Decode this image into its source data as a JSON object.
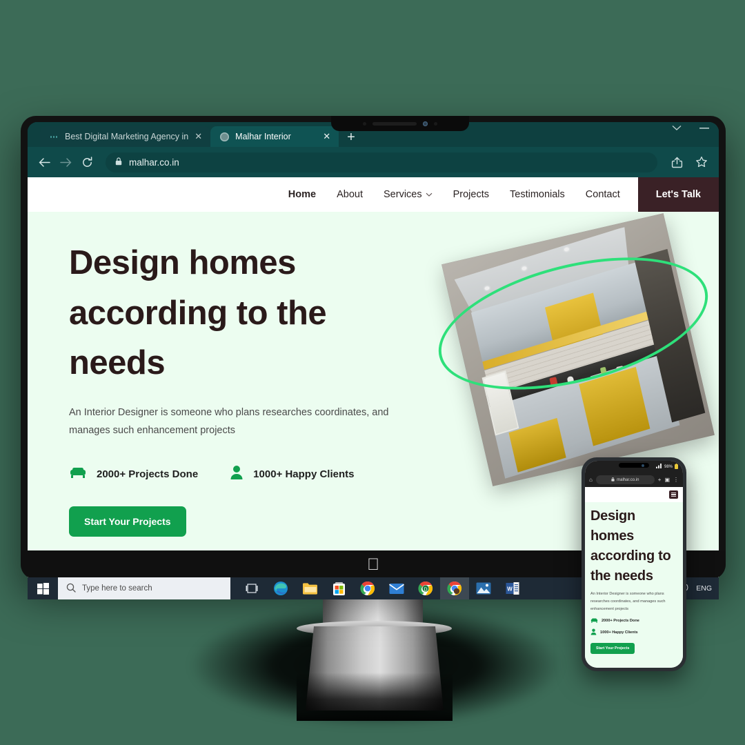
{
  "background_color": "#3c6b57",
  "browser": {
    "tabs": [
      {
        "title": "Best Digital Marketing Agency in",
        "favicon": "dots-icon",
        "close": "✕",
        "active": false
      },
      {
        "title": "Malhar Interior",
        "favicon": "globe-icon",
        "close": "✕",
        "active": true
      }
    ],
    "new_tab_label": "+",
    "window_controls": [
      "chevron-down-icon",
      "minimize-icon"
    ],
    "toolbar": {
      "back": "←",
      "forward": "→",
      "reload": "⟳",
      "lock": "🔒",
      "url": "malhar.co.in",
      "share": "share-icon",
      "bookmark": "star-icon"
    },
    "chrome_color": "#0f4a4a"
  },
  "site": {
    "nav": {
      "items": [
        {
          "label": "Home",
          "active": true
        },
        {
          "label": "About",
          "active": false
        },
        {
          "label": "Services",
          "active": false,
          "caret": "⌄"
        },
        {
          "label": "Projects",
          "active": false
        },
        {
          "label": "Testimonials",
          "active": false
        },
        {
          "label": "Contact",
          "active": false
        }
      ],
      "cta_label": "Let's Talk"
    },
    "hero": {
      "heading": "Design homes according to the needs",
      "paragraph": "An Interior Designer is someone who plans researches coordinates, and manages such enhancement projects",
      "stats": [
        {
          "icon": "sofa-icon",
          "label": "2000+ Projects Done"
        },
        {
          "icon": "person-icon",
          "label": "1000+ Happy Clients"
        }
      ],
      "button_label": "Start Your Projects",
      "bg_color": "#ecfdf0",
      "accent_green": "#11a04e",
      "ring_color": "#2ee07a",
      "heading_color": "#2a1a1a",
      "image_alt": "modular-kitchen-photo"
    }
  },
  "phone": {
    "status": {
      "signal": "signal-icon",
      "battery_text": "98%",
      "battery": "battery-icon"
    },
    "browser": {
      "home": "⌂",
      "lock": "🔒",
      "url": "malhar.co.in",
      "new_tab": "+",
      "tabs": "▣",
      "menu": "⋮"
    },
    "menu_icon": "hamburger-icon",
    "heading": "Design homes according to the needs",
    "paragraph": "An Interior Designer is someone who plans researches coordinates, and manages such enhancement projects",
    "stats": [
      "2000+ Projects Done",
      "1000+ Happy Clients"
    ],
    "button_label": "Start Your Projects"
  },
  "monitor": {
    "brand_logo": "apple-logo"
  },
  "taskbar": {
    "start": "windows-start-icon",
    "search_placeholder": "Type here to search",
    "search_icon": "search-icon",
    "task_view": "task-view-icon",
    "apps": [
      {
        "name": "edge-icon"
      },
      {
        "name": "file-explorer-icon"
      },
      {
        "name": "microsoft-store-icon"
      },
      {
        "name": "chrome-icon"
      },
      {
        "name": "mail-icon"
      },
      {
        "name": "chrome-dev-icon"
      },
      {
        "name": "chrome-active-icon",
        "active": true
      },
      {
        "name": "photos-icon"
      },
      {
        "name": "word-icon"
      }
    ],
    "tray": {
      "volume": "volume-icon",
      "language": "ENG"
    }
  }
}
